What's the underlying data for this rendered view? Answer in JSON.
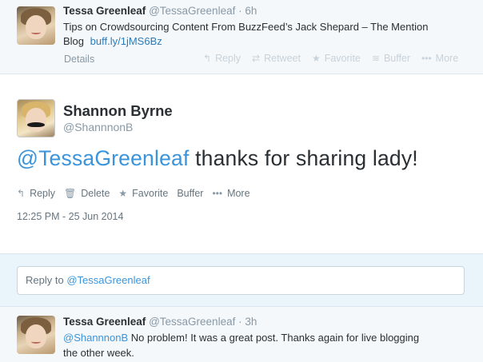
{
  "top_tweet": {
    "name": "Tessa Greenleaf",
    "handle": "@TessaGreenleaf",
    "time": "6h",
    "text_line1": "Tips on Crowdsourcing Content From BuzzFeed’s Jack Shepard – The Mention",
    "text_line2": "Blog",
    "link": "buff.ly/1jMS6Bz",
    "details_label": "Details",
    "actions": [
      "Reply",
      "Retweet",
      "Favorite",
      "Buffer",
      "More"
    ]
  },
  "focus_tweet": {
    "name": "Shannon Byrne",
    "handle": "@ShannnonB",
    "mention": "@TessaGreenleaf",
    "text": " thanks for sharing lady!",
    "actions": [
      "Reply",
      "Delete",
      "Favorite",
      "Buffer",
      "More"
    ],
    "timestamp": "12:25 PM - 25 Jun 2014"
  },
  "reply": {
    "prefix": "Reply to ",
    "mention": "@TessaGreenleaf"
  },
  "bottom_tweet": {
    "name": "Tessa Greenleaf",
    "handle": "@TessaGreenleaf",
    "time": "3h",
    "mention": "@ShannnonB",
    "text_line1": " No problem! It was a great post. Thanks again for live blogging",
    "text_line2": "the other week."
  },
  "colors": {
    "link": "#2b7bb9",
    "muted": "#8899a6",
    "reply_bg": "#eaf4fb"
  }
}
